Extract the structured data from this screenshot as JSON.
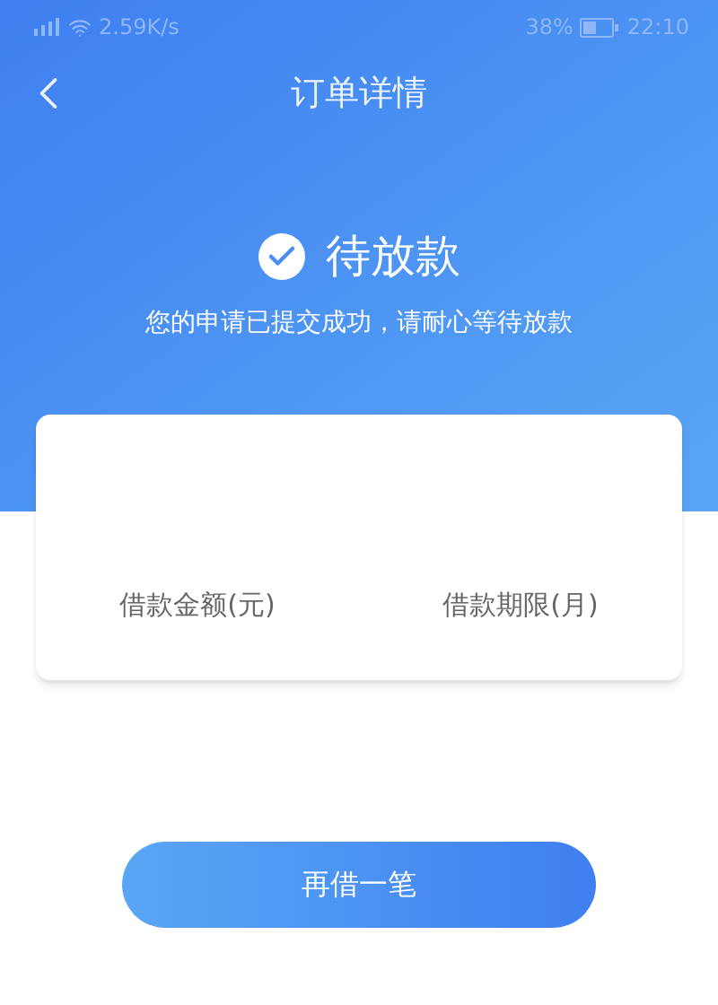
{
  "status_bar": {
    "network_speed": "2.59K/s",
    "battery_percent": "38%",
    "time": "22:10"
  },
  "nav": {
    "title": "订单详情"
  },
  "status": {
    "title": "待放款",
    "message": "您的申请已提交成功，请耐心等待放款"
  },
  "card": {
    "fields": [
      {
        "label": "借款金额(元)"
      },
      {
        "label": "借款期限(月)"
      }
    ]
  },
  "action_button": {
    "label": "再借一笔"
  }
}
